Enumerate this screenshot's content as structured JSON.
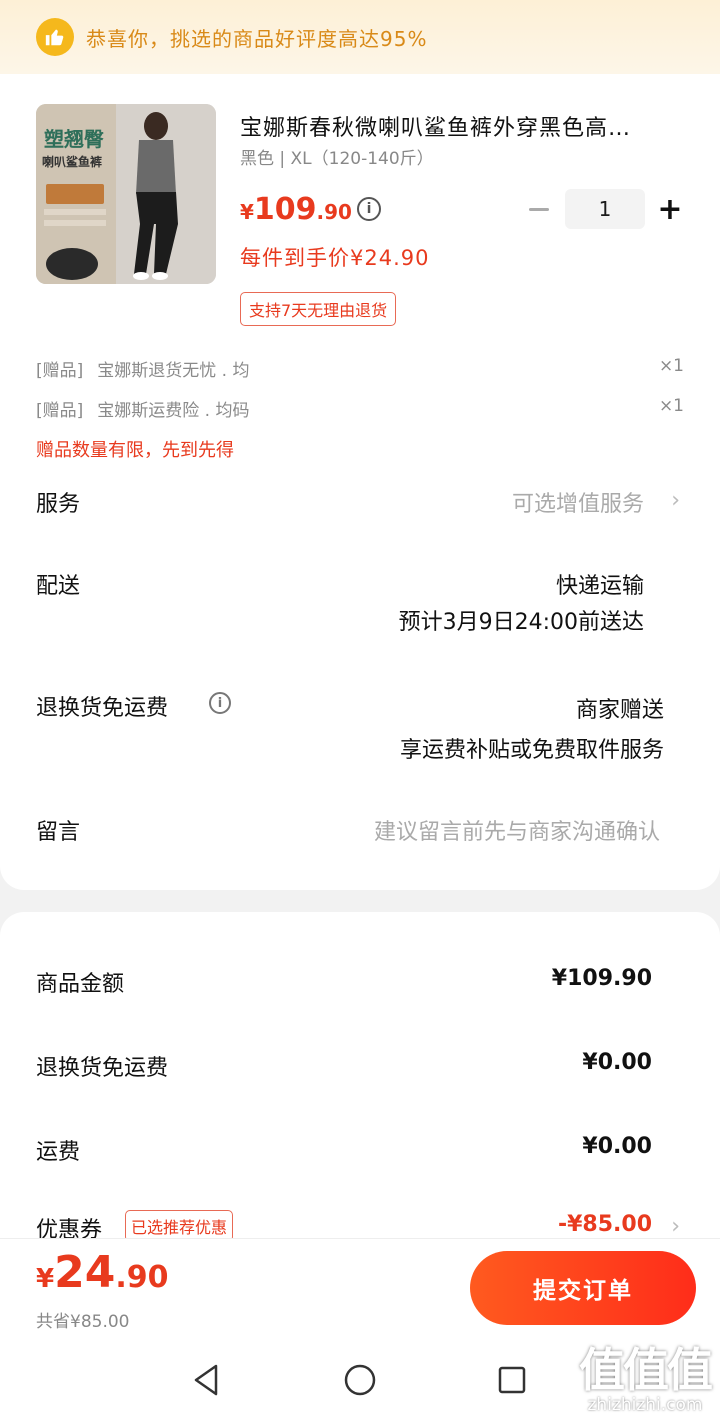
{
  "banner": {
    "text": "恭喜你，挑选的商品好评度高达95%",
    "icon": "thumbs-up-icon"
  },
  "product": {
    "image_text_1": "塑翘臀",
    "image_text_2": "喇叭鲨鱼裤",
    "title": "宝娜斯春秋微喇叭鲨鱼裤外穿黑色高…",
    "spec": "黑色 | XL（120-140斤）",
    "price_yen": "¥",
    "price_int": "109",
    "price_dec": ".90",
    "unit_price": "每件到手价¥24.90",
    "quantity": "1",
    "return_tag": "支持7天无理由退货"
  },
  "gifts": [
    {
      "tag": "[赠品]",
      "name": "宝娜斯退货无忧 . 均",
      "qty": "×1"
    },
    {
      "tag": "[赠品]",
      "name": "宝娜斯运费险 . 均码",
      "qty": "×1"
    }
  ],
  "gift_warning": "赠品数量有限，先到先得",
  "service": {
    "label": "服务",
    "value": "可选增值服务"
  },
  "delivery": {
    "label": "配送",
    "value": "快递运输",
    "eta": "预计3月9日24:00前送达"
  },
  "return_shipping": {
    "label": "退换货免运费",
    "value": "商家赠送",
    "detail": "享运费补贴或免费取件服务"
  },
  "message": {
    "label": "留言",
    "placeholder": "建议留言前先与商家沟通确认"
  },
  "summary": {
    "goods_label": "商品金额",
    "goods_value": "¥109.90",
    "return_label": "退换货免运费",
    "return_value": "¥0.00",
    "shipping_label": "运费",
    "shipping_value": "¥0.00",
    "coupon_label": "优惠券",
    "coupon_tag": "已选推荐优惠",
    "coupon_value": "-¥85.00"
  },
  "bottom": {
    "total_yen": "¥",
    "total_int": "24",
    "total_dec": ".90",
    "saved": "共省¥85.00",
    "submit": "提交订单"
  },
  "watermark": {
    "big": "值值值",
    "small": "zhizhizhi.com"
  },
  "colors": {
    "accent": "#e83a1e",
    "banner_text": "#d98a18",
    "button": "#ff3b1f"
  }
}
